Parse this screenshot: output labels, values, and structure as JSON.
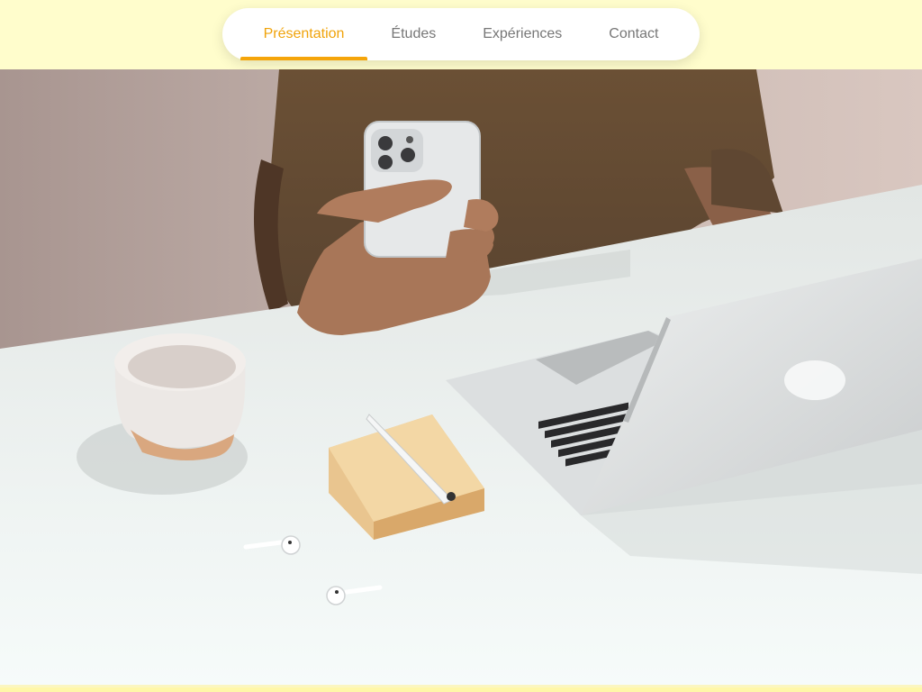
{
  "nav": {
    "items": [
      {
        "label": "Présentation",
        "active": true
      },
      {
        "label": "Études",
        "active": false
      },
      {
        "label": "Expériences",
        "active": false
      },
      {
        "label": "Contact",
        "active": false
      }
    ]
  },
  "colors": {
    "accent": "#f5a50a",
    "header_bg": "#fffdcc",
    "nav_text": "#777777"
  },
  "hero": {
    "image": "photo-of-person-holding-phone-at-desk-with-laptop"
  }
}
